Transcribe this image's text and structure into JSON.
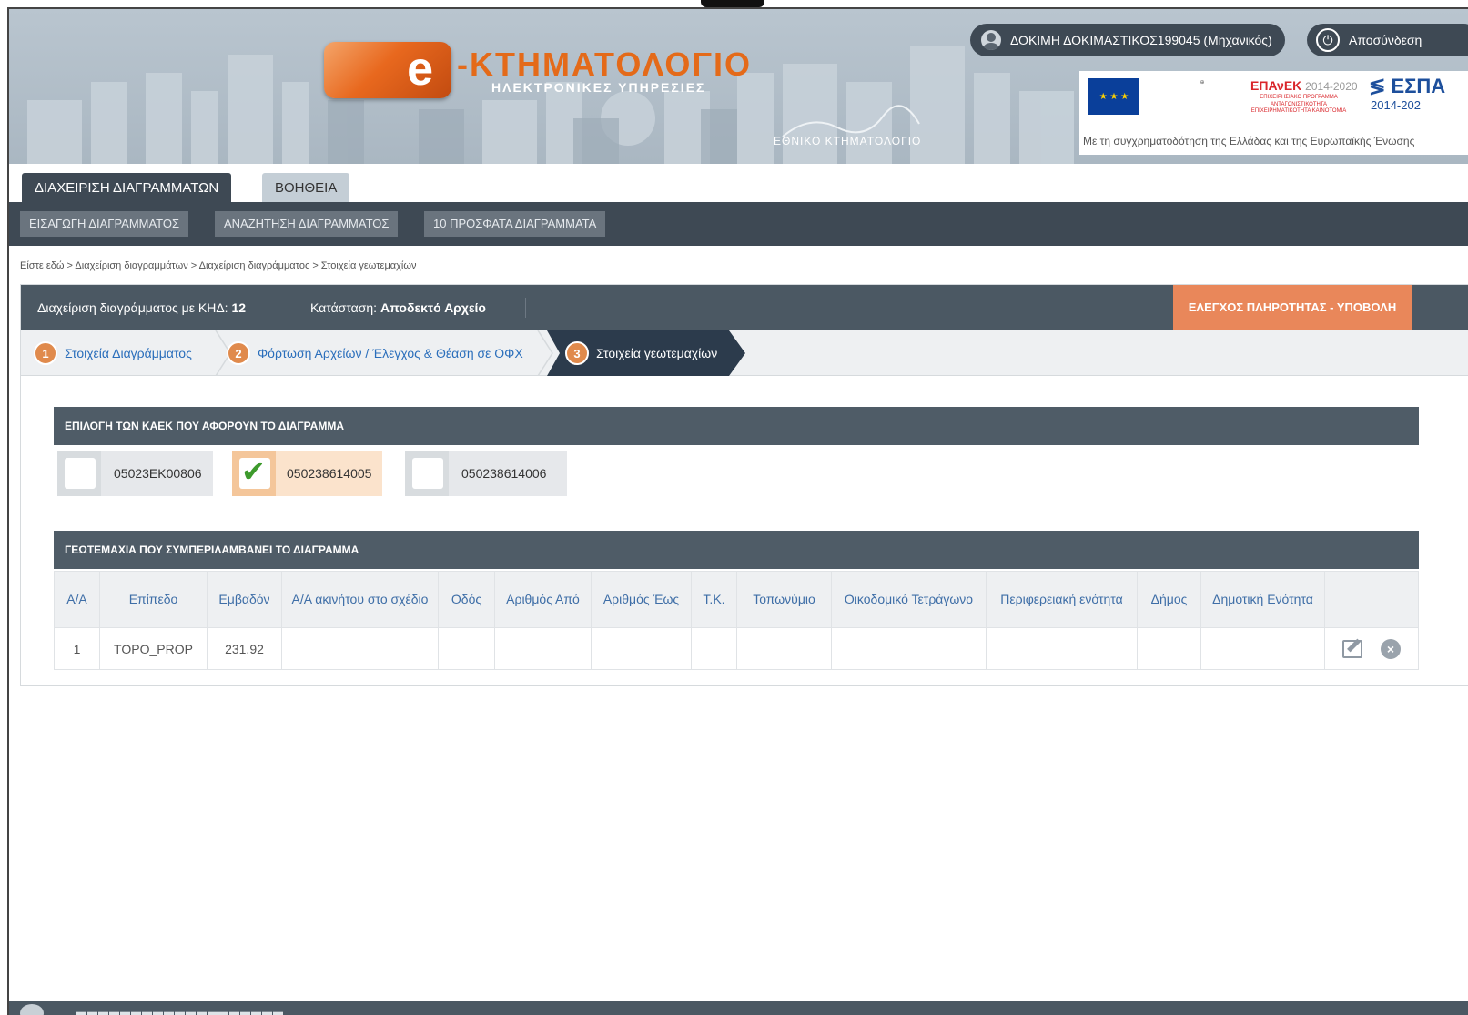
{
  "header": {
    "logo_letter": "e",
    "logo_title": "-ΚΤΗΜΑΤΟΛΟΓΙΟ",
    "logo_subtitle": "ΗΛΕΚΤΡΟΝΙΚΕΣ ΥΠΗΡΕΣΙΕΣ",
    "agency_label": "ΕΘΝΙΚΟ ΚΤΗΜΑΤΟΛΟΓΙΟ",
    "user_name": "ΔΟΚΙΜΗ ΔΟΚΙΜΑΣΤΙΚΟΣ199045 (Μηχανικός)",
    "logout_label": "Αποσύνδεση",
    "eu_banner": {
      "epanek": "ΕΠΑνΕΚ",
      "epanek_years": "2014-2020",
      "epanek_sub": "ΕΠΙΧΕΙΡΗΣΙΑΚΟ ΠΡΟΓΡΑΜΜΑ ΑΝΤΑΓΩΝΙΣΤΙΚΟΤΗΤΑ ΕΠΙΧΕΙΡΗΜΑΤΙΚΟΤΗΤΑ ΚΑΙΝΟΤΟΜΙΑ",
      "espa": "ΕΣΠΑ",
      "espa_years": "2014-202",
      "caption": "Με τη συγχρηματοδότηση της Ελλάδας και της Ευρωπαϊκής Ένωσης"
    }
  },
  "nav": {
    "tabs": [
      {
        "label": "ΔΙΑΧΕΙΡΙΣΗ ΔΙΑΓΡΑΜΜΑΤΩΝ"
      },
      {
        "label": "ΒΟΗΘΕΙΑ"
      }
    ],
    "subnav": [
      {
        "label": "ΕΙΣΑΓΩΓΗ ΔΙΑΓΡΑΜΜΑΤΟΣ"
      },
      {
        "label": "ΑΝΑΖΗΤΗΣΗ ΔΙΑΓΡΑΜΜΑΤΟΣ"
      },
      {
        "label": "10 ΠΡΟΣΦΑΤΑ ΔΙΑΓΡΑΜΜΑΤΑ"
      }
    ]
  },
  "breadcrumb": "Είστε εδώ > Διαχείριση διαγραμμάτων > Διαχείριση διαγράμματος > Στοιχεία γεωτεμαχίων",
  "panel": {
    "kid_label": "Διαχείριση διαγράμματος με ΚΗΔ:",
    "kid_value": "12",
    "status_label": "Κατάσταση:",
    "status_value": "Αποδεκτό Αρχείο",
    "submit_label": "ΕΛΕΓΧΟΣ ΠΛΗΡΟΤΗΤΑΣ - ΥΠΟΒΟΛΗ"
  },
  "steps": [
    {
      "num": "1",
      "label": "Στοιχεία Διαγράμματος"
    },
    {
      "num": "2",
      "label": "Φόρτωση Αρχείων / Έλεγχος & Θέαση σε ΟΦΧ"
    },
    {
      "num": "3",
      "label": "Στοιχεία γεωτεμαχίων"
    }
  ],
  "kaek_section": {
    "title": "ΕΠΙΛΟΓΗ ΤΩΝ ΚΑΕΚ ΠΟΥ ΑΦΟΡΟΥΝ ΤΟ ΔΙΑΓΡΑΜΜΑ",
    "items": [
      {
        "code": "05023EK00806",
        "checked": false
      },
      {
        "code": "050238614005",
        "checked": true
      },
      {
        "code": "050238614006",
        "checked": false
      }
    ]
  },
  "geo_section": {
    "title": "ΓΕΩΤΕΜΑΧΙΑ ΠΟΥ ΣΥΜΠΕΡΙΛΑΜΒΑΝΕΙ ΤΟ ΔΙΑΓΡΑΜΜΑ",
    "columns": [
      "Α/Α",
      "Επίπεδο",
      "Εμβαδόν",
      "Α/Α ακινήτου στο σχέδιο",
      "Οδός",
      "Αριθμός Από",
      "Αριθμός Έως",
      "Τ.Κ.",
      "Τοπωνύμιο",
      "Οικοδομικό Τετράγωνο",
      "Περιφερειακή ενότητα",
      "Δήμος",
      "Δημοτική Ενότητα",
      ""
    ],
    "rows": [
      [
        "1",
        "TOPO_PROP",
        "231,92",
        "",
        "",
        "",
        "",
        "",
        "",
        "",
        "",
        "",
        "",
        ""
      ]
    ]
  },
  "colors": {
    "dark_bar": "#3e4954",
    "accent_orange": "#e9875a",
    "step_active": "#2c3b4c",
    "link_blue": "#2a6ebb"
  }
}
